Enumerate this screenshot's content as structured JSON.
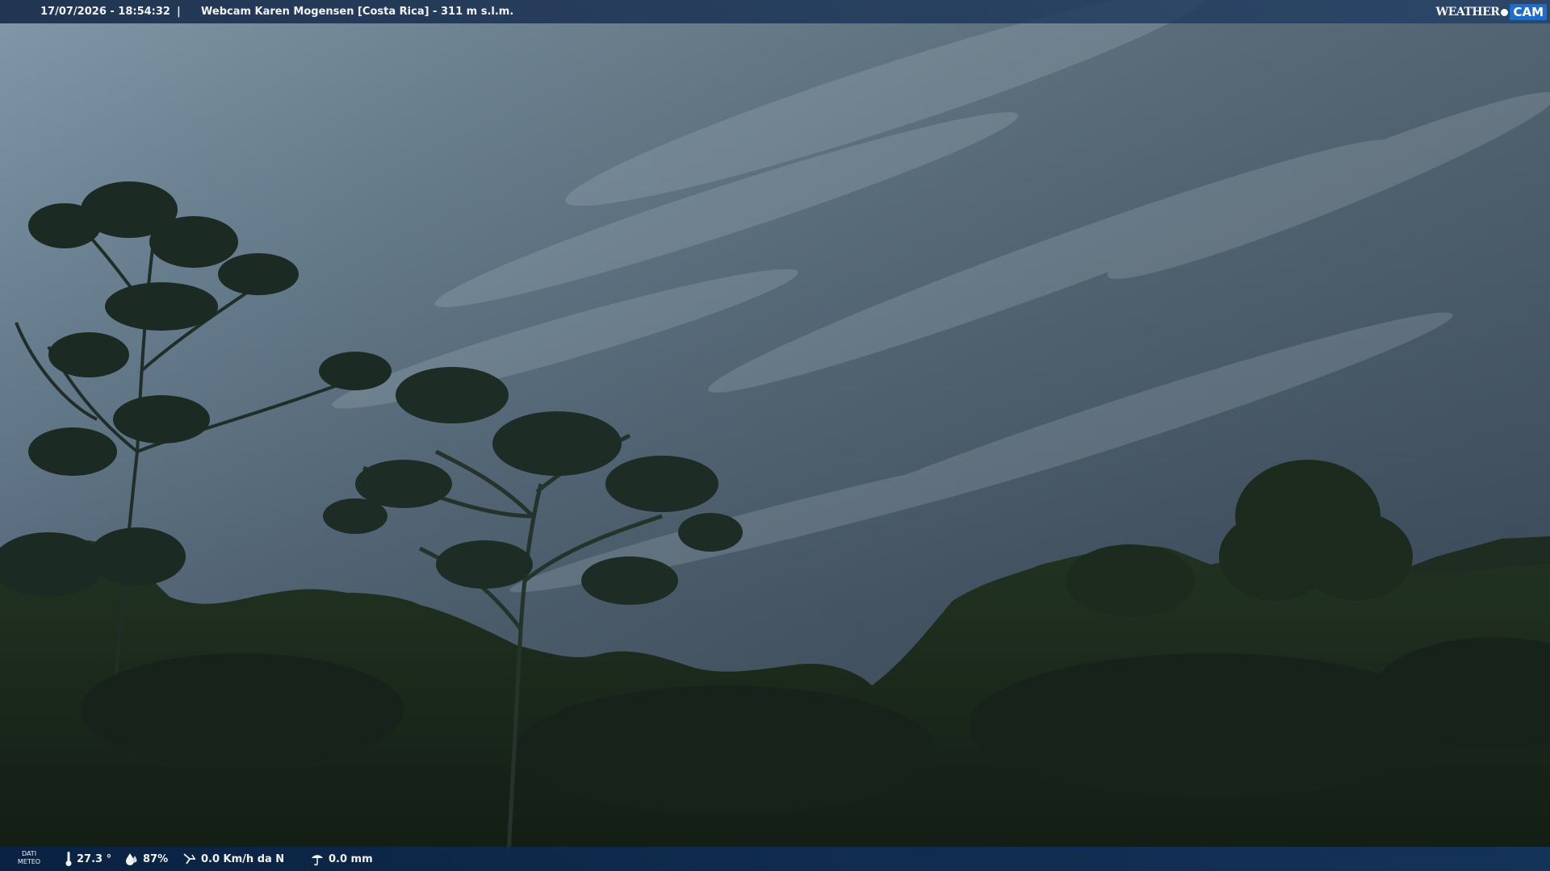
{
  "overlay": {
    "datetime": "17/07/2026 - 18:54:32",
    "separator": "|",
    "title": "Webcam Karen Mogensen [Costa Rica] - 311 m s.l.m.",
    "logo_weather": "WEATHER",
    "logo_cam": "CAM"
  },
  "meteo": {
    "label_line1": "DATI",
    "label_line2": "METEO",
    "temperature": "27.3 °",
    "humidity": "87%",
    "wind": "0.0 Km/h da N",
    "rain": "0.0 mm"
  },
  "icons": {
    "temperature": "thermometer-icon",
    "humidity": "humidity-icon",
    "wind": "wind-icon",
    "rain": "rain-icon"
  },
  "colors": {
    "sky_top": "#7f95a6",
    "sky_bottom": "#4a5d6e",
    "vegetation": "#1a2a1c",
    "bar": "#1a3a66",
    "logo_accent": "#1e6ec8"
  }
}
